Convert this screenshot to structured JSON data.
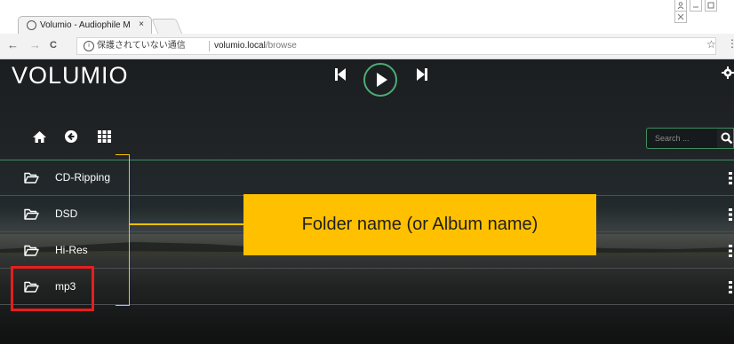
{
  "browser": {
    "tab_title": "Volumio - Audiophile M",
    "tab_close": "×",
    "back": "←",
    "forward": "→",
    "reload": "C",
    "info_mark": "i",
    "security_text": "保護されていない通信",
    "url_host": "volumio.local",
    "url_path": "/browse",
    "bookmark": "☆",
    "menu": "⋮"
  },
  "app": {
    "logo": "VOLUMIO",
    "transport": {
      "prev_icon": "skip-previous-icon",
      "play_icon": "play-icon",
      "next_icon": "skip-next-icon"
    },
    "toolbar": {
      "icons": [
        "home-icon",
        "back-circle-icon",
        "grid-icon"
      ]
    },
    "search": {
      "placeholder": "Search ..."
    },
    "accent_color": "#4eab75",
    "folders": [
      {
        "label": "CD-Ripping"
      },
      {
        "label": "DSD"
      },
      {
        "label": "Hi-Res"
      },
      {
        "label": "mp3"
      }
    ]
  },
  "annotation": {
    "callout": "Folder name (or Album name)",
    "callout_color": "#ffc000",
    "highlight_color": "#e61e1e"
  }
}
